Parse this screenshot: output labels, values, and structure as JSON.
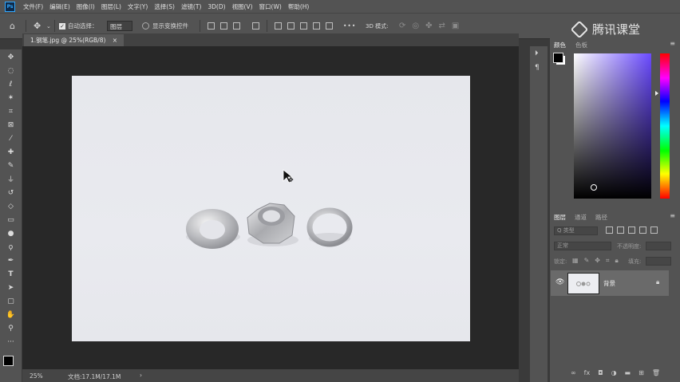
{
  "app": {
    "logo": "Ps"
  },
  "menu": [
    "文件(F)",
    "编辑(E)",
    "图像(I)",
    "图层(L)",
    "文字(Y)",
    "选择(S)",
    "滤镜(T)",
    "3D(D)",
    "视图(V)",
    "窗口(W)",
    "帮助(H)"
  ],
  "options": {
    "auto_select_label": "自动选择：",
    "auto_select_checked": true,
    "target_value": "图层",
    "show_transform_label": "显示变换控件",
    "more": "•••"
  },
  "document": {
    "tab_title": "1.钢笔.jpg @ 25%(RGB/8)",
    "close": "×",
    "zoom": "25%",
    "doc_info": "文档:17.1M/17.1M",
    "status_arrow": "›"
  },
  "watermark": {
    "text": "腾讯课堂"
  },
  "panels": {
    "color_tabs": [
      "颜色",
      "色板"
    ],
    "layer_tabs": [
      "图层",
      "通道",
      "路径"
    ],
    "kind_placeholder": "Q 类型",
    "blend_mode": "正常",
    "opacity_label": "不透明度:",
    "lock_label": "锁定:",
    "fill_label": "填充:",
    "layers": [
      {
        "name": "背景",
        "visible": true,
        "locked": true
      }
    ]
  },
  "colors": {
    "accent": "#31a8ff",
    "panel": "#535353",
    "canvas_bg": "#282828"
  }
}
